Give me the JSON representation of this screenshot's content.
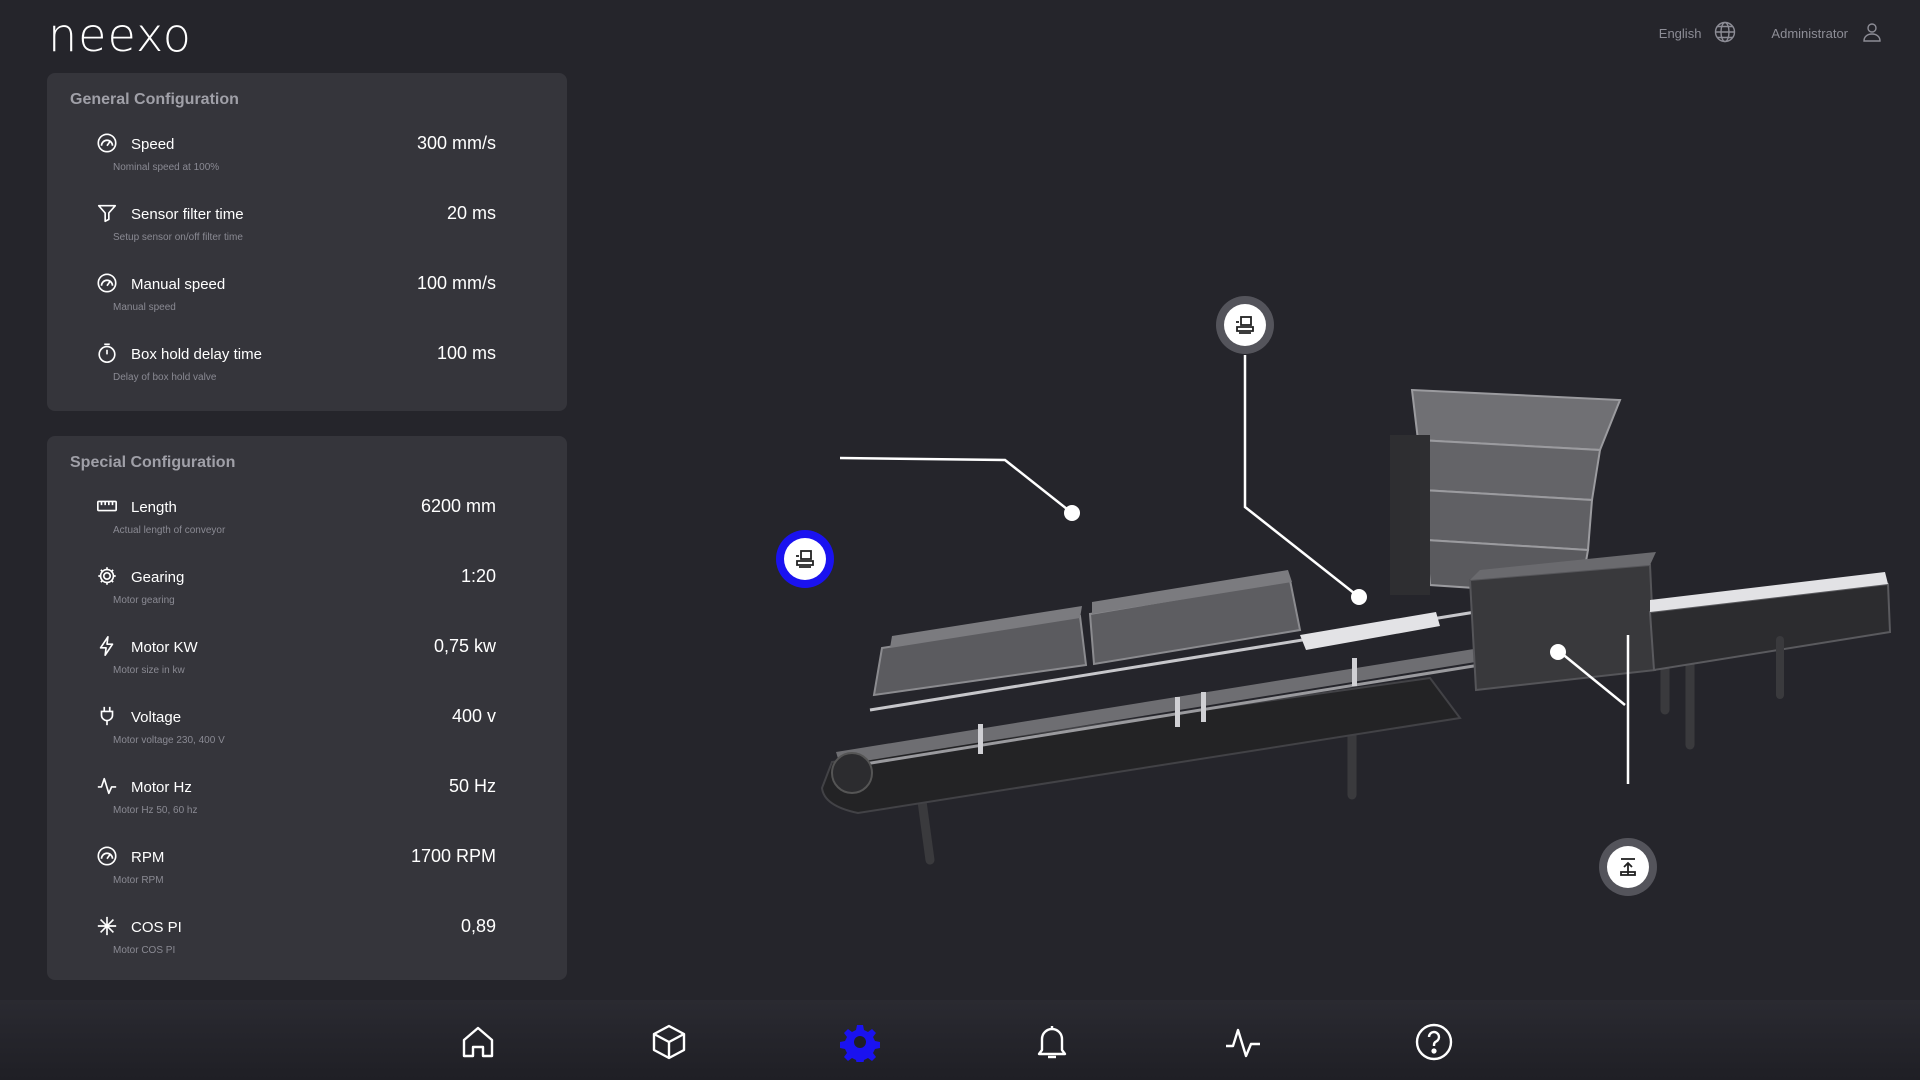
{
  "brand": {
    "logo_text": "neexo"
  },
  "topbar": {
    "language": "English",
    "user": "Administrator"
  },
  "general": {
    "title": "General Configuration",
    "rows": [
      {
        "icon": "gauge-icon",
        "label": "Speed",
        "sub": "Nominal speed at 100%",
        "value": "300 mm/s"
      },
      {
        "icon": "filter-icon",
        "label": "Sensor filter time",
        "sub": "Setup sensor on/off filter time",
        "value": "20 ms"
      },
      {
        "icon": "gauge-icon",
        "label": "Manual speed",
        "sub": "Manual speed",
        "value": "100 mm/s"
      },
      {
        "icon": "stopwatch-icon",
        "label": "Box hold delay time",
        "sub": "Delay of box hold valve",
        "value": "100 ms"
      }
    ]
  },
  "special": {
    "title": "Special Configuration",
    "rows": [
      {
        "icon": "ruler-icon",
        "label": "Length",
        "sub": "Actual length of conveyor",
        "value": "6200 mm"
      },
      {
        "icon": "gear-icon",
        "label": "Gearing",
        "sub": "Motor gearing",
        "value": "1:20"
      },
      {
        "icon": "lightning-icon",
        "label": "Motor KW",
        "sub": "Motor size in kw",
        "value": "0,75 kw"
      },
      {
        "icon": "plug-icon",
        "label": "Voltage",
        "sub": "Motor voltage 230, 400 V",
        "value": "400 v"
      },
      {
        "icon": "pulse-icon",
        "label": "Motor Hz",
        "sub": "Motor Hz 50, 60 hz",
        "value": "50 Hz"
      },
      {
        "icon": "gauge-icon",
        "label": "RPM",
        "sub": "Motor RPM",
        "value": "1700 RPM"
      },
      {
        "icon": "asterisk-icon",
        "label": "COS PI",
        "sub": "Motor COS PI",
        "value": "0,89"
      }
    ]
  },
  "hotspots": [
    {
      "name": "hotspot-conveyor-sensor",
      "icon": "sensor-device-icon",
      "active": true
    },
    {
      "name": "hotspot-stack-sensor",
      "icon": "sensor-device-icon",
      "active": false
    },
    {
      "name": "hotspot-lift-unit",
      "icon": "upload-icon",
      "active": false
    }
  ],
  "nav": [
    {
      "name": "nav-home",
      "icon": "home-icon",
      "active": false
    },
    {
      "name": "nav-products",
      "icon": "box-icon",
      "active": false
    },
    {
      "name": "nav-settings",
      "icon": "gear-icon",
      "active": true
    },
    {
      "name": "nav-alerts",
      "icon": "bell-icon",
      "active": false
    },
    {
      "name": "nav-activity",
      "icon": "pulse-icon",
      "active": false
    },
    {
      "name": "nav-help",
      "icon": "help-icon",
      "active": false
    }
  ],
  "colors": {
    "accent": "#1a12f0",
    "panel": "#35353b",
    "background": "#25252b"
  }
}
